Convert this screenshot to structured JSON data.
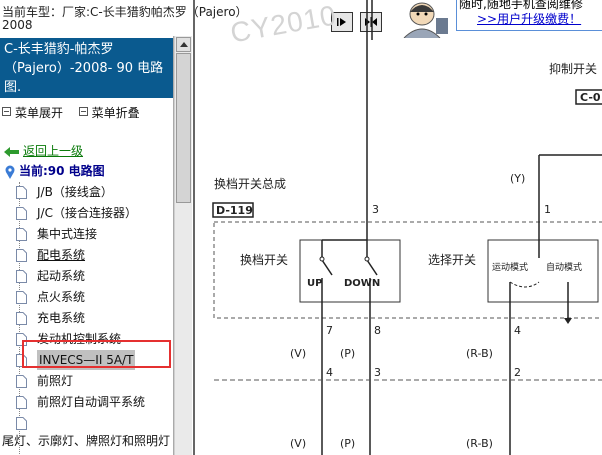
{
  "header": {
    "crumb_line1": "当前车型：厂家:C-长丰猎豹帕杰罗（Pajero）",
    "crumb_line2": "2008",
    "watermark": "CY2010",
    "banner_line1": "随时,随地手机查阅维修",
    "banner_link": ">>用户升级缴费！"
  },
  "sidebar": {
    "model_title_line1": "C-长丰猎豹-帕杰罗",
    "model_title_line2": "（Pajero）-2008- 90 电路",
    "model_title_line3": "图.",
    "expand_label": "菜单展开",
    "collapse_label": "菜单折叠",
    "back_label": "返回上一级",
    "current_label": "当前:90 电路图",
    "items": [
      {
        "label": "J/B（接线盒）"
      },
      {
        "label": "J/C（接合连接器）"
      },
      {
        "label": "集中式连接"
      },
      {
        "label": "配电系统"
      },
      {
        "label": "起动系统"
      },
      {
        "label": "点火系统"
      },
      {
        "label": "充电系统"
      },
      {
        "label": "发动机控制系统"
      },
      {
        "label": "INVECS—II 5A/T"
      },
      {
        "label": "前照灯"
      },
      {
        "label": "前照灯自动调平系统"
      },
      {
        "label": ""
      }
    ],
    "bottom_item": "尾灯、示廓灯、牌照灯和照明灯"
  },
  "diagram": {
    "title_right": "抑制开关",
    "connector_right": "C-0",
    "assembly_label": "换档开关总成",
    "connector_left": "D-119",
    "pin_3_top": "3",
    "pin_1_top": "1",
    "wire_y": "(Y)",
    "shift_switch": "换档开关",
    "select_switch": "选择开关",
    "up": "UP",
    "down": "DOWN",
    "sport_mode": "运动模式",
    "auto_mode": "自动模式",
    "pin_7": "7",
    "pin_8": "8",
    "pin_4": "4",
    "wire_v1": "(V)",
    "wire_p1": "(P)",
    "wire_rb1": "(R-B)",
    "junc_4": "4",
    "junc_3": "3",
    "junc_2": "2",
    "wire_v2": "(V)",
    "wire_p2": "(P)",
    "wire_rb2": "(R-B)"
  },
  "colors": {
    "title_bg": "#0a5a8f",
    "highlight_border": "#e53030",
    "back_link": "#0a7a0a",
    "current": "#00008b"
  }
}
